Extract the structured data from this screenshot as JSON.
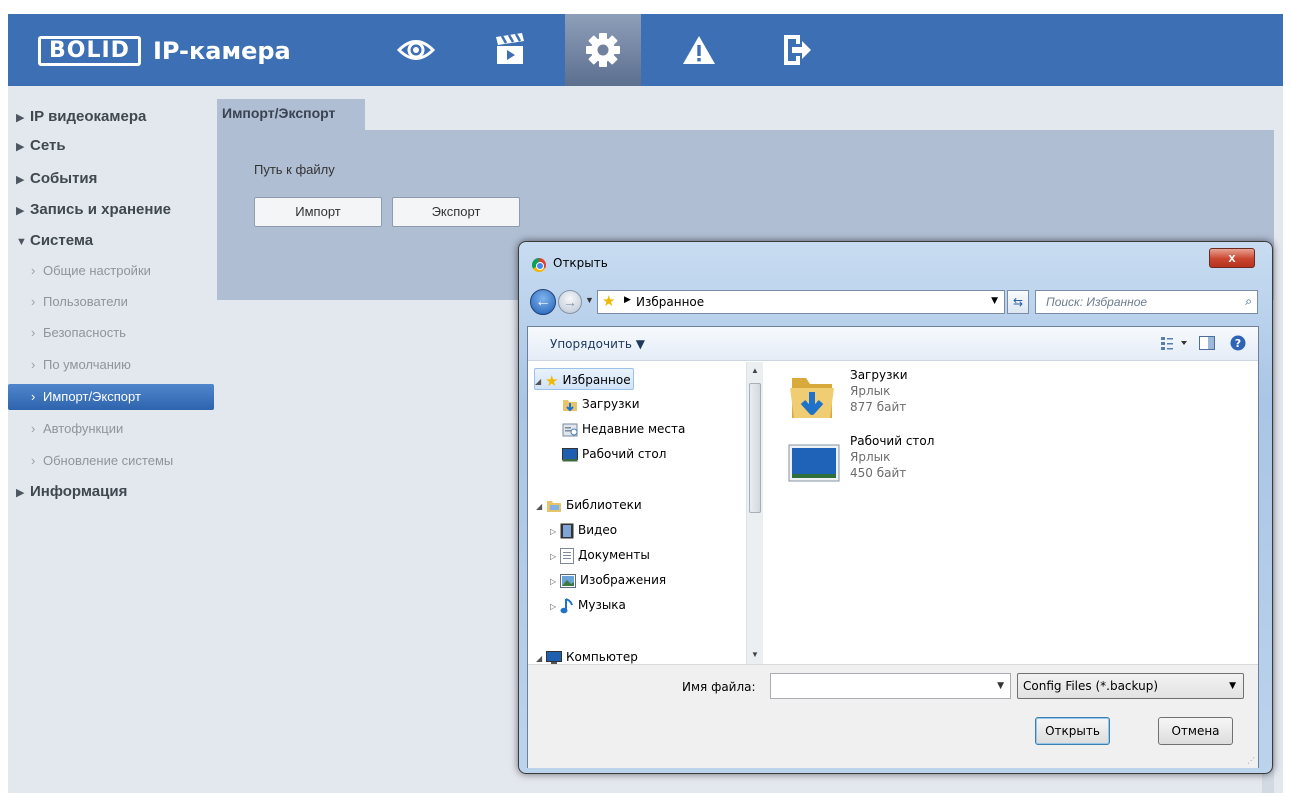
{
  "app": {
    "logo": "BOLID",
    "title": "IP-камера"
  },
  "colors": {
    "topbar": "#3d6fb4",
    "sidebar_bg": "#e3e7ee",
    "panel": "#b0bed3",
    "active_item": "#2d64ad"
  },
  "top_nav": [
    {
      "icon": "eye-icon",
      "label": "Просмотр"
    },
    {
      "icon": "clapperboard-icon",
      "label": "Воспроизведение"
    },
    {
      "icon": "gear-icon",
      "label": "Настройки",
      "active": true
    },
    {
      "icon": "warning-icon",
      "label": "Тревога"
    },
    {
      "icon": "logout-icon",
      "label": "Выход"
    }
  ],
  "sidebar": {
    "sections": [
      {
        "label": "IP видеокамера",
        "marker": "▶"
      },
      {
        "label": "Сеть",
        "marker": "▶"
      },
      {
        "label": "События",
        "marker": "▶"
      },
      {
        "label": "Запись и хранение",
        "marker": "▶"
      },
      {
        "label": "Система",
        "marker": "▼"
      },
      {
        "label": "Информация",
        "marker": "▶"
      }
    ],
    "system_items": [
      {
        "label": "Общие настройки"
      },
      {
        "label": "Пользователи"
      },
      {
        "label": "Безопасность"
      },
      {
        "label": "По умолчанию"
      },
      {
        "label": "Импорт/Экспорт",
        "active": true
      },
      {
        "label": "Автофункции"
      },
      {
        "label": "Обновление системы"
      }
    ]
  },
  "main": {
    "tab": "Импорт/Экспорт",
    "path_label": "Путь к файлу",
    "import_button": "Импорт",
    "export_button": "Экспорт"
  },
  "dialog": {
    "title": "Открыть",
    "close": "x",
    "address": "Избранное",
    "search_placeholder": "Поиск: Избранное",
    "organize": "Упорядочить ▼",
    "tree": {
      "favorites": "Избранное",
      "downloads": "Загрузки",
      "recent": "Недавние места",
      "desktop": "Рабочий стол",
      "libraries": "Библиотеки",
      "video": "Видео",
      "documents": "Документы",
      "images": "Изображения",
      "music": "Музыка",
      "computer": "Компьютер"
    },
    "files": [
      {
        "name": "Загрузки",
        "type": "Ярлык",
        "size": "877 байт",
        "icon": "downloads-folder-icon"
      },
      {
        "name": "Рабочий стол",
        "type": "Ярлык",
        "size": "450 байт",
        "icon": "desktop-icon"
      }
    ],
    "filename_label": "Имя файла:",
    "filename_value": "",
    "filter": "Config Files (*.backup)",
    "open_button": "Открыть",
    "cancel_button": "Отмена"
  }
}
